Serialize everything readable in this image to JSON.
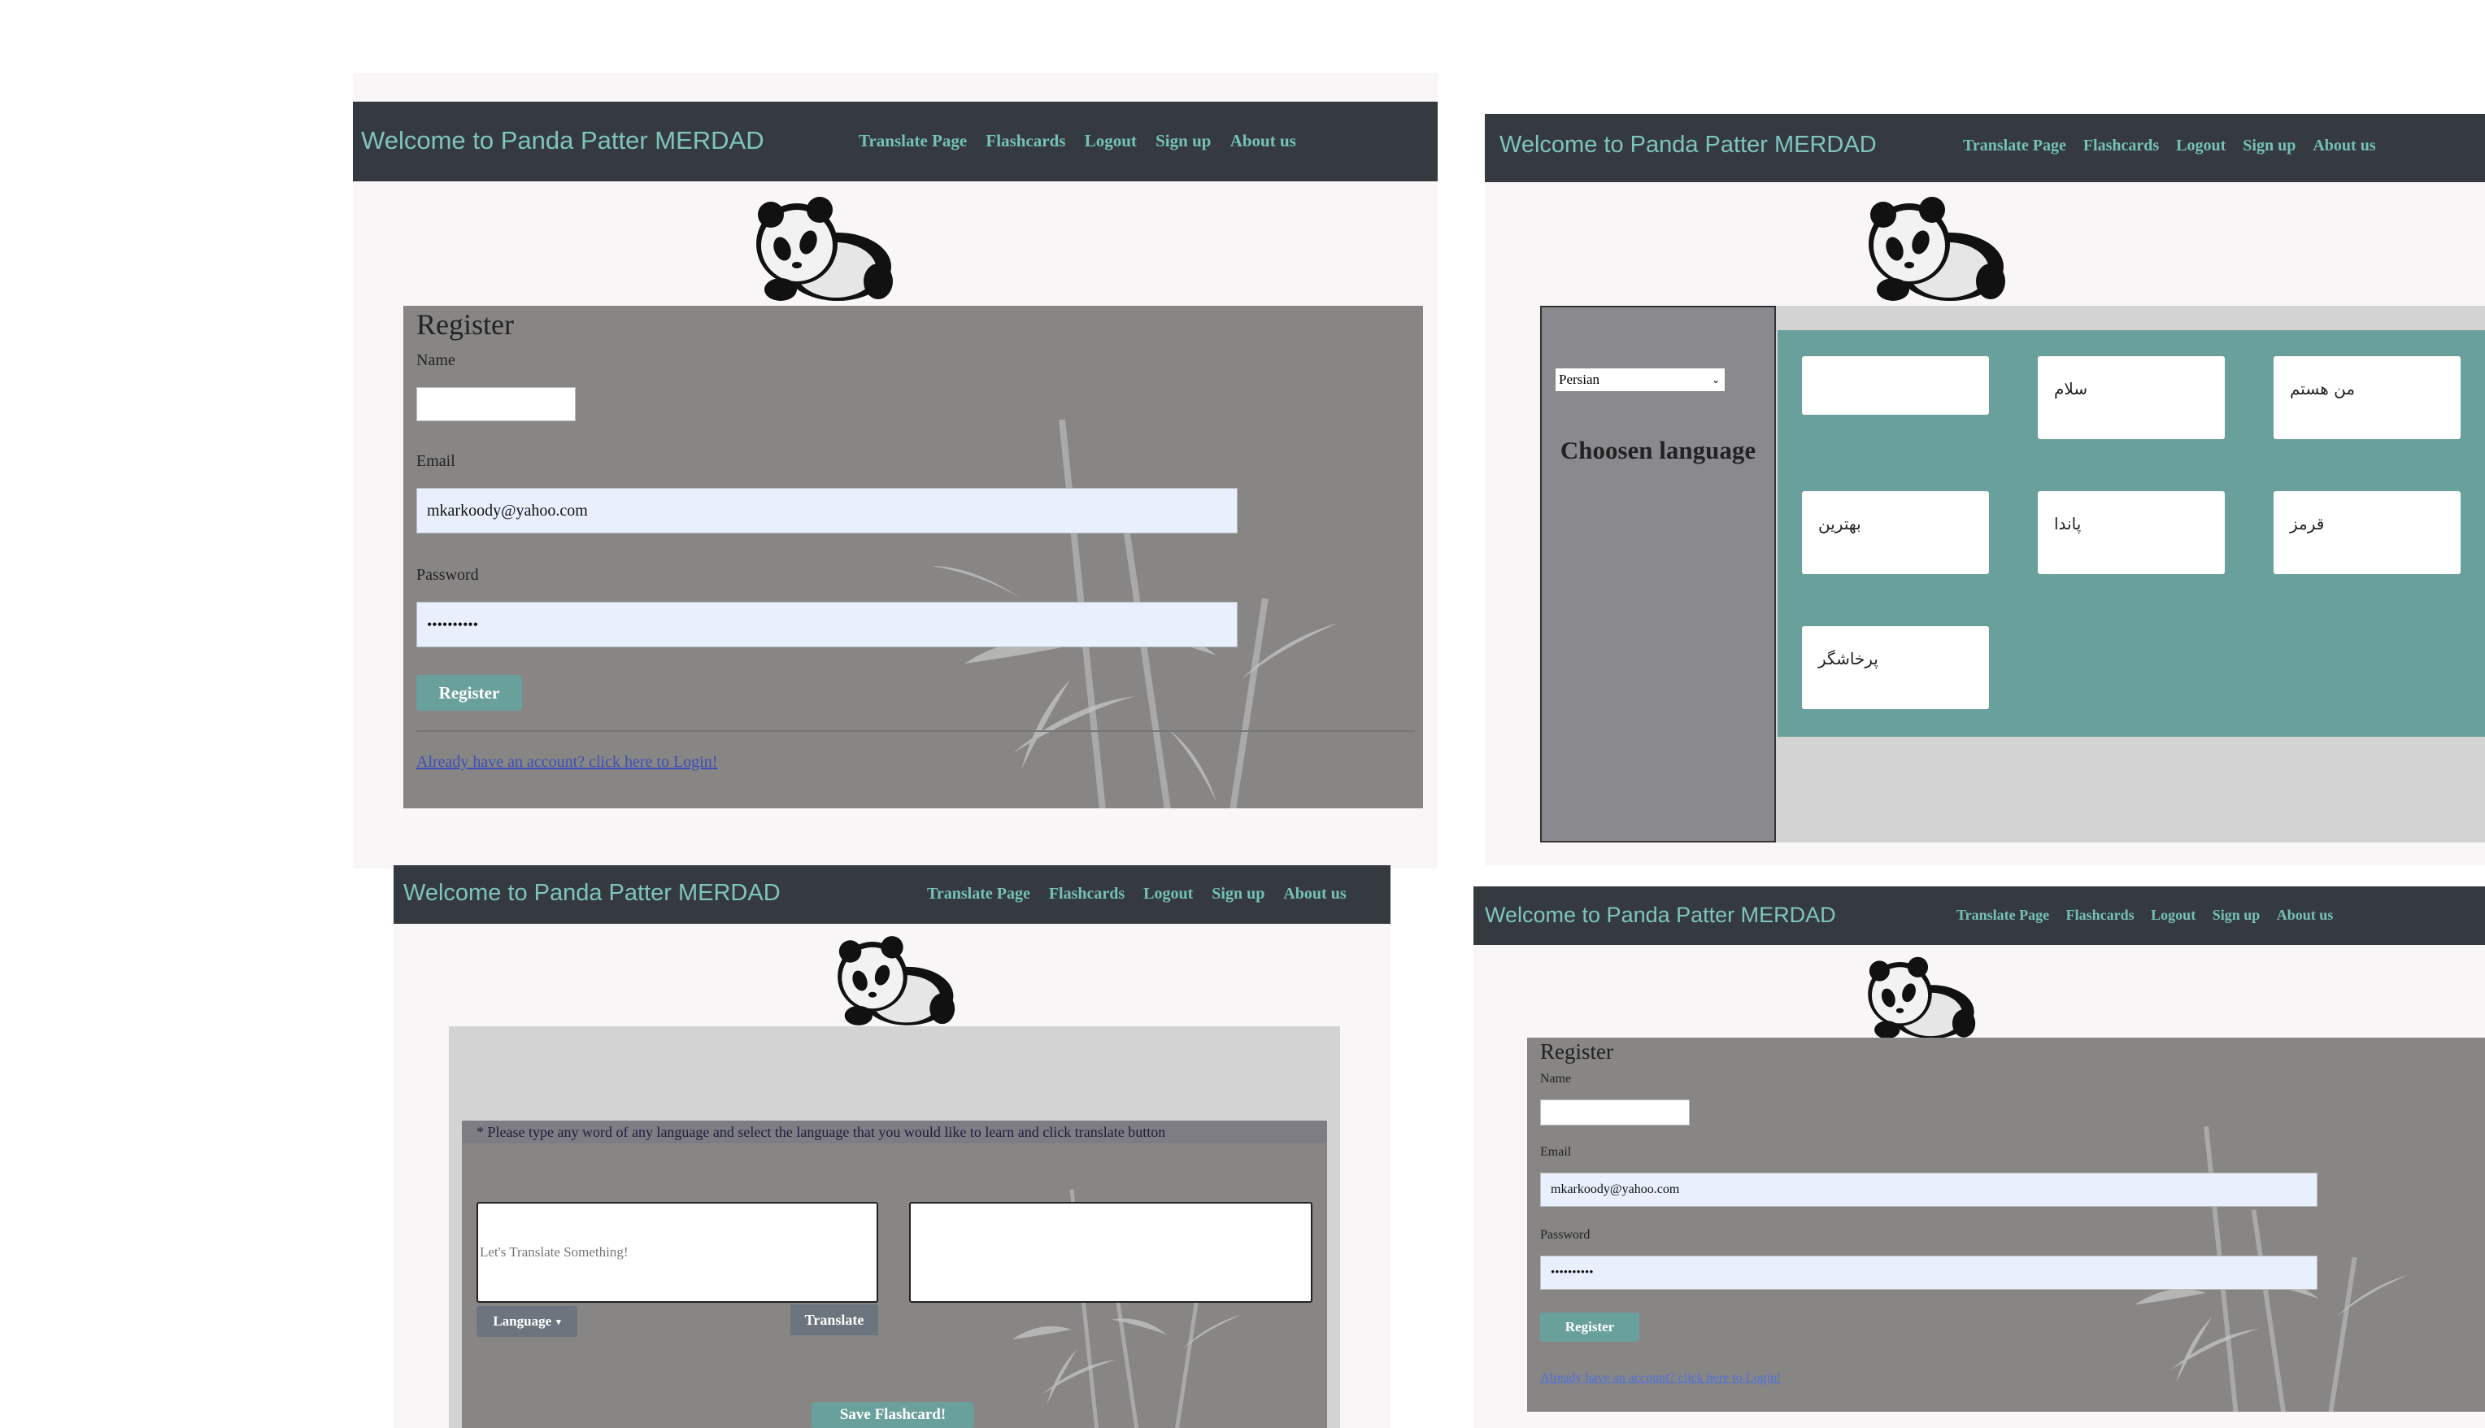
{
  "app": {
    "brand": "Welcome to Panda Patter MERDAD",
    "nav": [
      "Translate Page",
      "Flashcards",
      "Logout",
      "Sign up",
      "About us"
    ]
  },
  "register": {
    "title": "Register",
    "name_label": "Name",
    "name_value": "",
    "email_label": "Email",
    "email_value": "mkarkoody@yahoo.com",
    "password_label": "Password",
    "password_value": "••••••••••",
    "button": "Register",
    "login_link": "Already have an account? click here to Login!"
  },
  "language": {
    "select_value": "Persian",
    "heading": "Choosen language",
    "words": [
      "",
      "سلام",
      "من هستم",
      "بهترین",
      "پاندا",
      "قرمز",
      "پرخاشگر"
    ]
  },
  "translate": {
    "instruction": "* Please type any word of any language and select the language that you would like to learn and click translate button",
    "input_placeholder": "Let's Translate Something!",
    "language_button": "Language",
    "translate_button": "Translate",
    "save_button": "Save Flashcard!"
  },
  "colors": {
    "navbar": "#343a40",
    "brand": "#7fc4bd",
    "teal_panel": "#6aa09b",
    "card_gray": "#878685",
    "page_bg": "#f8f6f7"
  }
}
